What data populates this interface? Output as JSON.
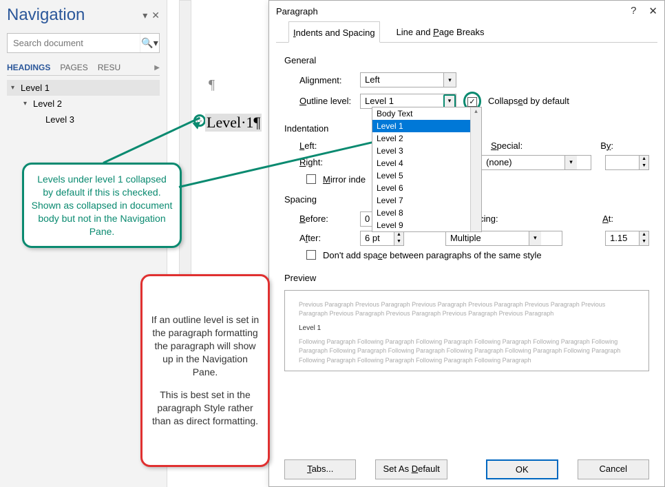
{
  "nav": {
    "title": "Navigation",
    "search_placeholder": "Search document",
    "tabs": {
      "headings": "HEADINGS",
      "pages": "PAGES",
      "results": "RESU"
    },
    "tree": [
      {
        "label": "Level 1",
        "level": 1,
        "caret": "▾",
        "selected": true
      },
      {
        "label": "Level 2",
        "level": 2,
        "caret": "▾"
      },
      {
        "label": "Level 3",
        "level": 3,
        "caret": ""
      }
    ]
  },
  "doc": {
    "heading_text": "Level·1¶",
    "pilcrow": "¶"
  },
  "dialog": {
    "title": "Paragraph",
    "help": "?",
    "close": "✕",
    "tabs": {
      "indents": "Indents and Spacing",
      "breaks": "Line and Page Breaks"
    },
    "general": {
      "label": "General",
      "alignment_lbl": "Alignment:",
      "alignment_val": "Left",
      "outline_lbl": "Outline level:",
      "outline_val": "Level 1",
      "collapsed_lbl": "Collapsed by default",
      "collapsed_checked": "✓",
      "dropdown": [
        "Body Text",
        "Level 1",
        "Level 2",
        "Level 3",
        "Level 4",
        "Level 5",
        "Level 6",
        "Level 7",
        "Level 8",
        "Level 9"
      ]
    },
    "indentation": {
      "label": "Indentation",
      "left_lbl": "Left:",
      "right_lbl": "Right:",
      "special_lbl": "Special:",
      "special_val": "(none)",
      "by_lbl": "By:",
      "mirror_lbl": "Mirror inde"
    },
    "spacing": {
      "label": "Spacing",
      "before_lbl": "Before:",
      "before_val": "0 pt",
      "after_lbl": "After:",
      "after_val": "6 pt",
      "line_lbl": "Line spacing:",
      "line_val": "Multiple",
      "at_lbl": "At:",
      "at_val": "1.15",
      "noadd_lbl": "Don't add space between paragraphs of the same style"
    },
    "preview": {
      "label": "Preview",
      "prev_text": "Previous Paragraph Previous Paragraph Previous Paragraph Previous Paragraph Previous Paragraph Previous Paragraph Previous Paragraph Previous Paragraph Previous Paragraph Previous Paragraph",
      "main_text": "Level 1",
      "foll_text": "Following Paragraph Following Paragraph Following Paragraph Following Paragraph Following Paragraph Following Paragraph Following Paragraph Following Paragraph Following Paragraph Following Paragraph Following Paragraph Following Paragraph Following Paragraph Following Paragraph Following Paragraph"
    },
    "buttons": {
      "tabs": "Tabs...",
      "setdefault": "Set As Default",
      "ok": "OK",
      "cancel": "Cancel"
    }
  },
  "callouts": {
    "green": "Levels under level 1 collapsed by default if this is checked. Shown as collapsed in document body but not in the Navigation Pane.",
    "red1": "If an outline level is set in the paragraph formatting the paragraph will show up in the Navigation Pane.",
    "red2": "This is best set in the paragraph Style rather than as direct formatting."
  }
}
